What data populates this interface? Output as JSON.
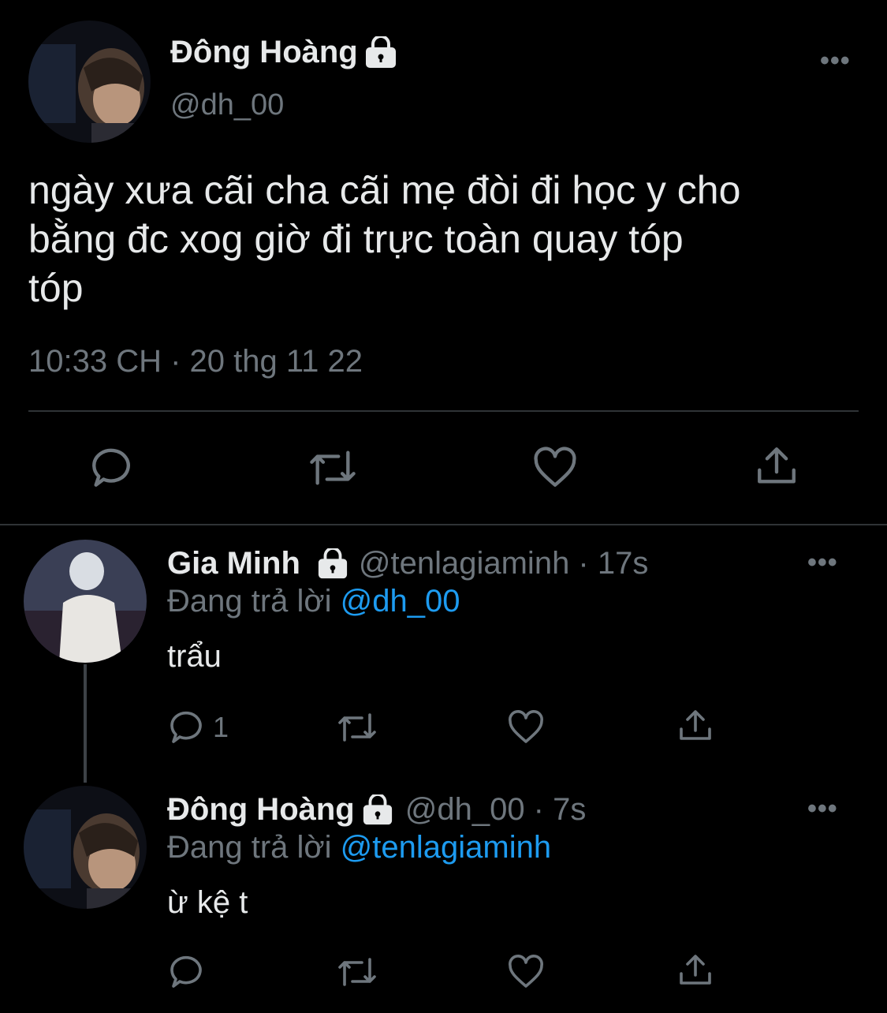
{
  "main_tweet": {
    "display_name": "Đông Hoàng",
    "handle": "@dh_00",
    "text_lines": [
      "ngày xưa cãi cha cãi mẹ đòi đi học y cho",
      "bằng đc xog giờ đi trực toàn quay tóp",
      "tóp"
    ],
    "timestamp": "10:33 CH · 20 thg 11 22"
  },
  "reply1": {
    "display_name": "Gia Minh",
    "handle_time": "@tenlagiaminh · 17s",
    "replying_prefix": "Đang trả lời",
    "replying_to": "@dh_00",
    "text": "trẩu",
    "reply_count": "1"
  },
  "reply2": {
    "display_name": "Đông Hoàng",
    "handle_time": "@dh_00 · 7s",
    "replying_prefix": "Đang trả lời",
    "replying_to": "@tenlagiaminh",
    "text": "ừ kệ t"
  },
  "more_label": "•••",
  "icons": [
    "reply-icon",
    "retweet-icon",
    "like-icon",
    "share-icon",
    "lock-icon",
    "more-icon"
  ],
  "colors": {
    "background": "#000000",
    "text": "#e7e9ea",
    "muted": "#6e767d",
    "link": "#1d9bf0",
    "divider": "#2f3336"
  }
}
